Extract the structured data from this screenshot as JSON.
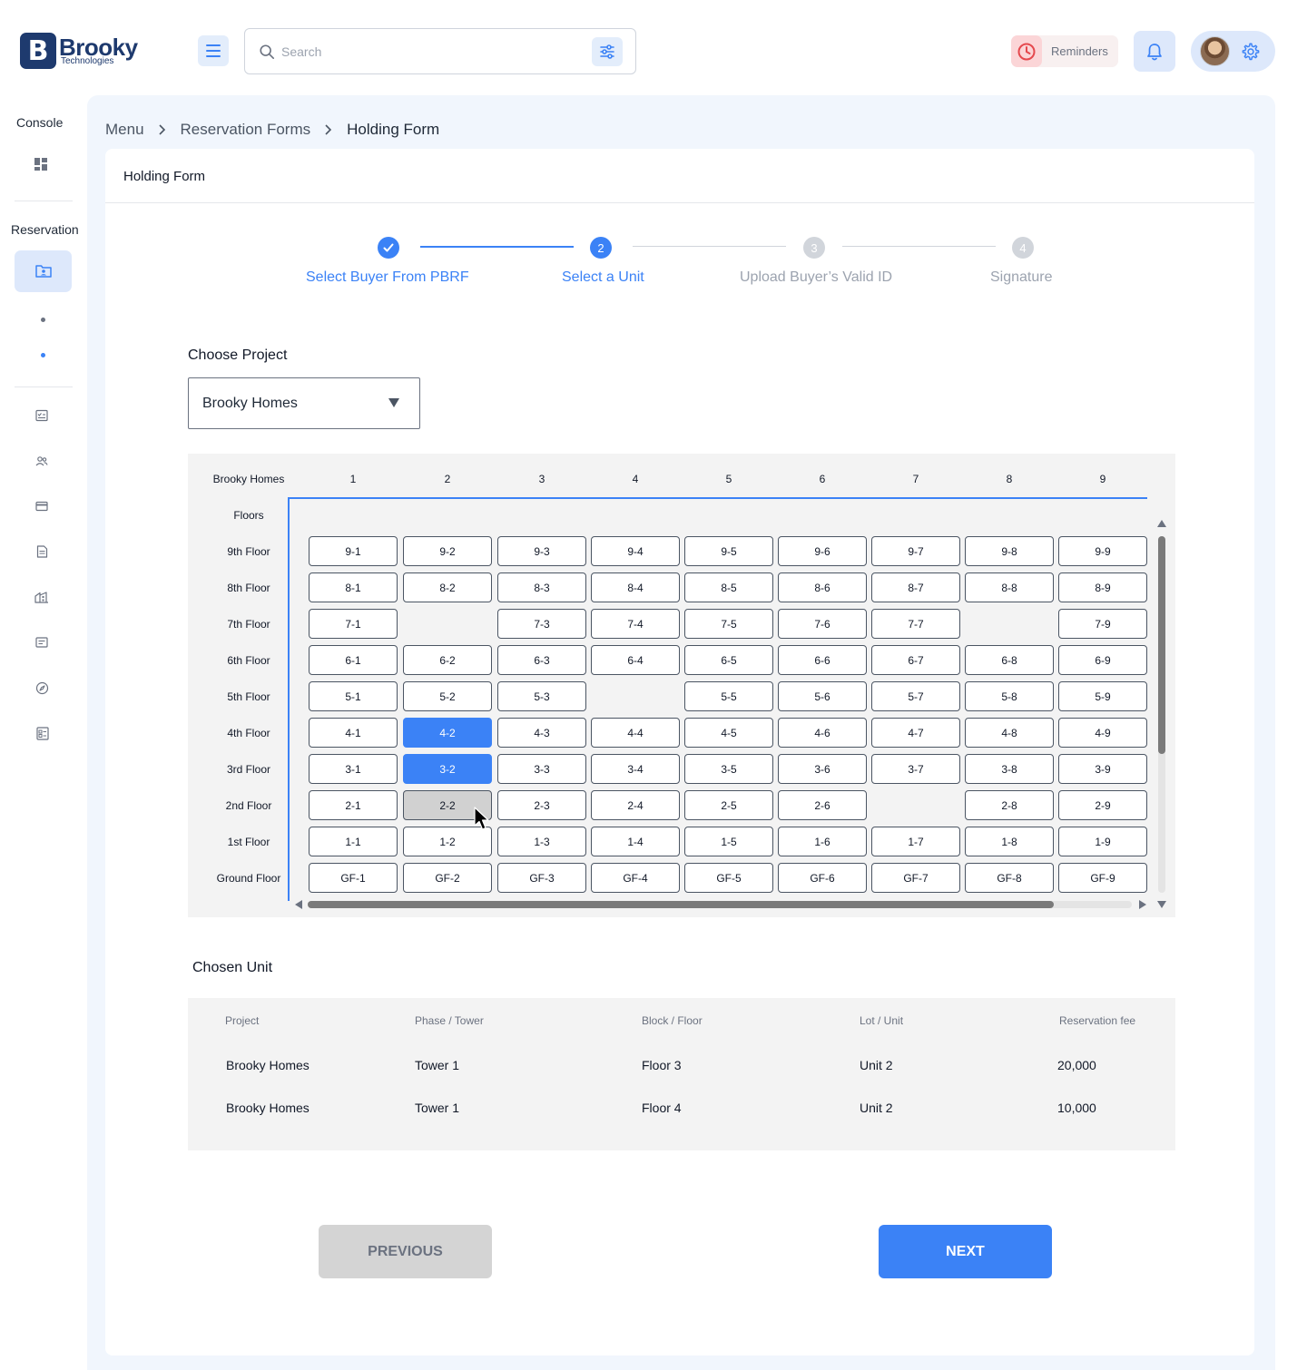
{
  "brand": {
    "name": "Brooky",
    "sub": "Technologies",
    "mark": "B"
  },
  "header": {
    "search_placeholder": "Search",
    "reminders_label": "Reminders"
  },
  "sidebar": {
    "console_label": "Console",
    "reservation_label": "Reservation"
  },
  "breadcrumb": [
    "Menu",
    "Reservation Forms",
    "Holding Form"
  ],
  "card_title": "Holding Form",
  "steps": [
    {
      "label": "Select Buyer From PBRF",
      "status": "done"
    },
    {
      "label": "Select a Unit",
      "number": "2",
      "status": "active"
    },
    {
      "label": "Upload Buyer’s Valid ID",
      "number": "3",
      "status": "pending"
    },
    {
      "label": "Signature",
      "number": "4",
      "status": "pending"
    }
  ],
  "choose_project": {
    "label": "Choose Project",
    "selected": "Brooky Homes"
  },
  "grid": {
    "corner_label": "Brooky Homes",
    "floors_label": "Floors",
    "columns": [
      "1",
      "2",
      "3",
      "4",
      "5",
      "6",
      "7",
      "8",
      "9"
    ],
    "rows": [
      {
        "floor": "9th Floor",
        "units": [
          "9-1",
          "9-2",
          "9-3",
          "9-4",
          "9-5",
          "9-6",
          "9-7",
          "9-8",
          "9-9"
        ]
      },
      {
        "floor": "8th Floor",
        "units": [
          "8-1",
          "8-2",
          "8-3",
          "8-4",
          "8-5",
          "8-6",
          "8-7",
          "8-8",
          "8-9"
        ]
      },
      {
        "floor": "7th Floor",
        "units": [
          "7-1",
          "",
          "7-3",
          "7-4",
          "7-5",
          "7-6",
          "7-7",
          "",
          "7-9"
        ]
      },
      {
        "floor": "6th Floor",
        "units": [
          "6-1",
          "6-2",
          "6-3",
          "6-4",
          "6-5",
          "6-6",
          "6-7",
          "6-8",
          "6-9"
        ]
      },
      {
        "floor": "5th Floor",
        "units": [
          "5-1",
          "5-2",
          "5-3",
          "",
          "5-5",
          "5-6",
          "5-7",
          "5-8",
          "5-9"
        ]
      },
      {
        "floor": "4th Floor",
        "units": [
          "4-1",
          "4-2",
          "4-3",
          "4-4",
          "4-5",
          "4-6",
          "4-7",
          "4-8",
          "4-9"
        ]
      },
      {
        "floor": "3rd Floor",
        "units": [
          "3-1",
          "3-2",
          "3-3",
          "3-4",
          "3-5",
          "3-6",
          "3-7",
          "3-8",
          "3-9"
        ]
      },
      {
        "floor": "2nd Floor",
        "units": [
          "2-1",
          "2-2",
          "2-3",
          "2-4",
          "2-5",
          "2-6",
          "",
          "2-8",
          "2-9"
        ]
      },
      {
        "floor": "1st Floor",
        "units": [
          "1-1",
          "1-2",
          "1-3",
          "1-4",
          "1-5",
          "1-6",
          "1-7",
          "1-8",
          "1-9"
        ]
      },
      {
        "floor": "Ground Floor",
        "units": [
          "GF-1",
          "GF-2",
          "GF-3",
          "GF-4",
          "GF-5",
          "GF-6",
          "GF-7",
          "GF-8",
          "GF-9"
        ]
      }
    ],
    "selected_units": [
      "4-2",
      "3-2"
    ],
    "hovered_unit": "2-2"
  },
  "chosen_unit": {
    "label": "Chosen Unit",
    "headers": [
      "Project",
      "Phase / Tower",
      "Block / Floor",
      "Lot / Unit",
      "Reservation fee"
    ],
    "rows": [
      [
        "Brooky Homes",
        "Tower 1",
        "Floor 3",
        "Unit 2",
        "20,000"
      ],
      [
        "Brooky Homes",
        "Tower 1",
        "Floor 4",
        "Unit 2",
        "10,000"
      ]
    ]
  },
  "buttons": {
    "previous": "PREVIOUS",
    "next": "NEXT"
  },
  "colors": {
    "accent": "#3b82f6",
    "brand": "#1e3a6e",
    "reminder": "#e5484d"
  }
}
